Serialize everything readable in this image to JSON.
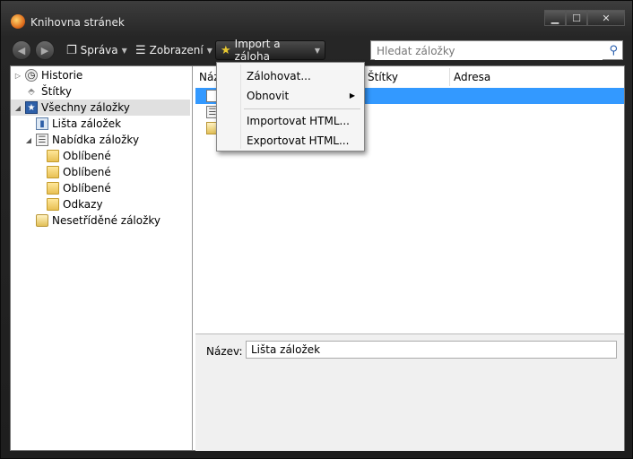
{
  "window": {
    "title": "Knihovna stránek"
  },
  "toolbar": {
    "manage_label": "Správa",
    "views_label": "Zobrazení",
    "import_label": "Import a záloha",
    "search_placeholder": "Hledat záložky"
  },
  "tree": {
    "items": [
      {
        "label": "Historie"
      },
      {
        "label": "Štítky"
      },
      {
        "label": "Všechny záložky"
      },
      {
        "label": "Lišta záložek"
      },
      {
        "label": "Nabídka záložky"
      },
      {
        "label": "Oblíbené"
      },
      {
        "label": "Oblíbené"
      },
      {
        "label": "Oblíbené"
      },
      {
        "label": "Odkazy"
      },
      {
        "label": "Nesetříděné záložky"
      }
    ]
  },
  "list": {
    "columns": [
      "Náz",
      "Štítky",
      "Adresa"
    ]
  },
  "detail": {
    "name_label": "Název:",
    "name_value": "Lišta záložek"
  },
  "menu": {
    "items": [
      "Zálohovat...",
      "Obnovit",
      "Importovat HTML...",
      "Exportovat HTML..."
    ]
  }
}
